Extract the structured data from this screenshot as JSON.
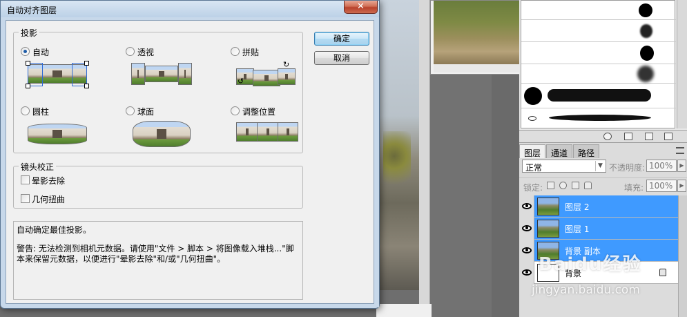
{
  "dialog": {
    "title": "自动对齐图层",
    "close_label": "✕",
    "projection": {
      "legend": "投影",
      "options": [
        {
          "label": "自动",
          "checked": true
        },
        {
          "label": "透视",
          "checked": false
        },
        {
          "label": "拼贴",
          "checked": false
        },
        {
          "label": "圆柱",
          "checked": false
        },
        {
          "label": "球面",
          "checked": false
        },
        {
          "label": "调整位置",
          "checked": false
        }
      ]
    },
    "lens": {
      "legend": "镜头校正",
      "options": [
        {
          "label": "晕影去除",
          "checked": false
        },
        {
          "label": "几何扭曲",
          "checked": false
        }
      ]
    },
    "info": {
      "line1": "自动确定最佳投影。",
      "warning": "警告: 无法检测到相机元数据。请使用\"文件 > 脚本 > 将图像载入堆栈...\"脚本来保留元数据，以便进行\"晕影去除\"和/或\"几何扭曲\"。"
    },
    "ok_label": "确定",
    "cancel_label": "取消"
  },
  "layers_panel": {
    "tabs": [
      {
        "label": "图层",
        "active": true
      },
      {
        "label": "通道",
        "active": false
      },
      {
        "label": "路径",
        "active": false
      }
    ],
    "blend_mode": "正常",
    "opacity_label": "不透明度:",
    "opacity_value": "100%",
    "lock_label": "锁定:",
    "fill_label": "填充:",
    "fill_value": "100%",
    "layers": [
      {
        "name": "图层 2",
        "selected": true,
        "visible": true
      },
      {
        "name": "图层 1",
        "selected": true,
        "visible": true
      },
      {
        "name": "背景 副本",
        "selected": true,
        "visible": true
      },
      {
        "name": "背景",
        "selected": false,
        "visible": true,
        "locked": true
      }
    ]
  },
  "watermark": {
    "brand": "Baidu经验",
    "url": "jingyan.baidu.com"
  },
  "colors": {
    "selection_blue": "#3f9aff",
    "dialog_frame": "#c7d8ea",
    "close_red": "#c8503a"
  }
}
